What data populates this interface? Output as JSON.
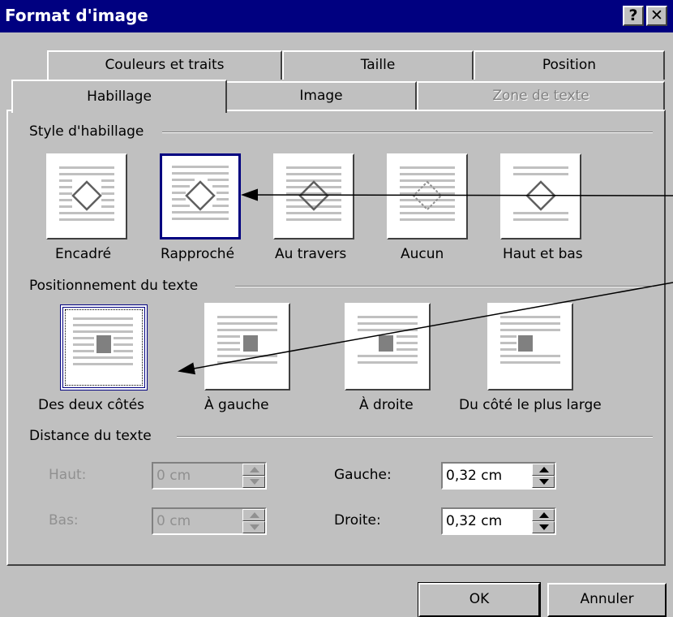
{
  "window": {
    "title": "Format d'image",
    "help_label": "?",
    "close_label": "✕"
  },
  "tabs": {
    "row1": [
      "Couleurs et traits",
      "Taille",
      "Position"
    ],
    "row2": [
      "Habillage",
      "Image",
      "Zone de texte"
    ],
    "active": "Habillage",
    "disabled": "Zone de texte"
  },
  "wrap_style": {
    "group_label": "Style d'habillage",
    "options": [
      "Encadré",
      "Rapproché",
      "Au travers",
      "Aucun",
      "Haut et bas"
    ],
    "selected": "Rapproché"
  },
  "text_position": {
    "group_label": "Positionnement du texte",
    "options": [
      "Des deux côtés",
      "À gauche",
      "À droite",
      "Du côté le plus large"
    ],
    "selected": "Des deux côtés"
  },
  "distance": {
    "group_label": "Distance du texte",
    "haut_label": "Haut:",
    "haut_value": "0 cm",
    "bas_label": "Bas:",
    "bas_value": "0 cm",
    "gauche_label": "Gauche:",
    "gauche_value": "0,32 cm",
    "droite_label": "Droite:",
    "droite_value": "0,32 cm"
  },
  "buttons": {
    "ok": "OK",
    "cancel": "Annuler"
  },
  "colors": {
    "titlebar": "#000080",
    "face": "#c0c0c0",
    "selection": "#000080"
  }
}
